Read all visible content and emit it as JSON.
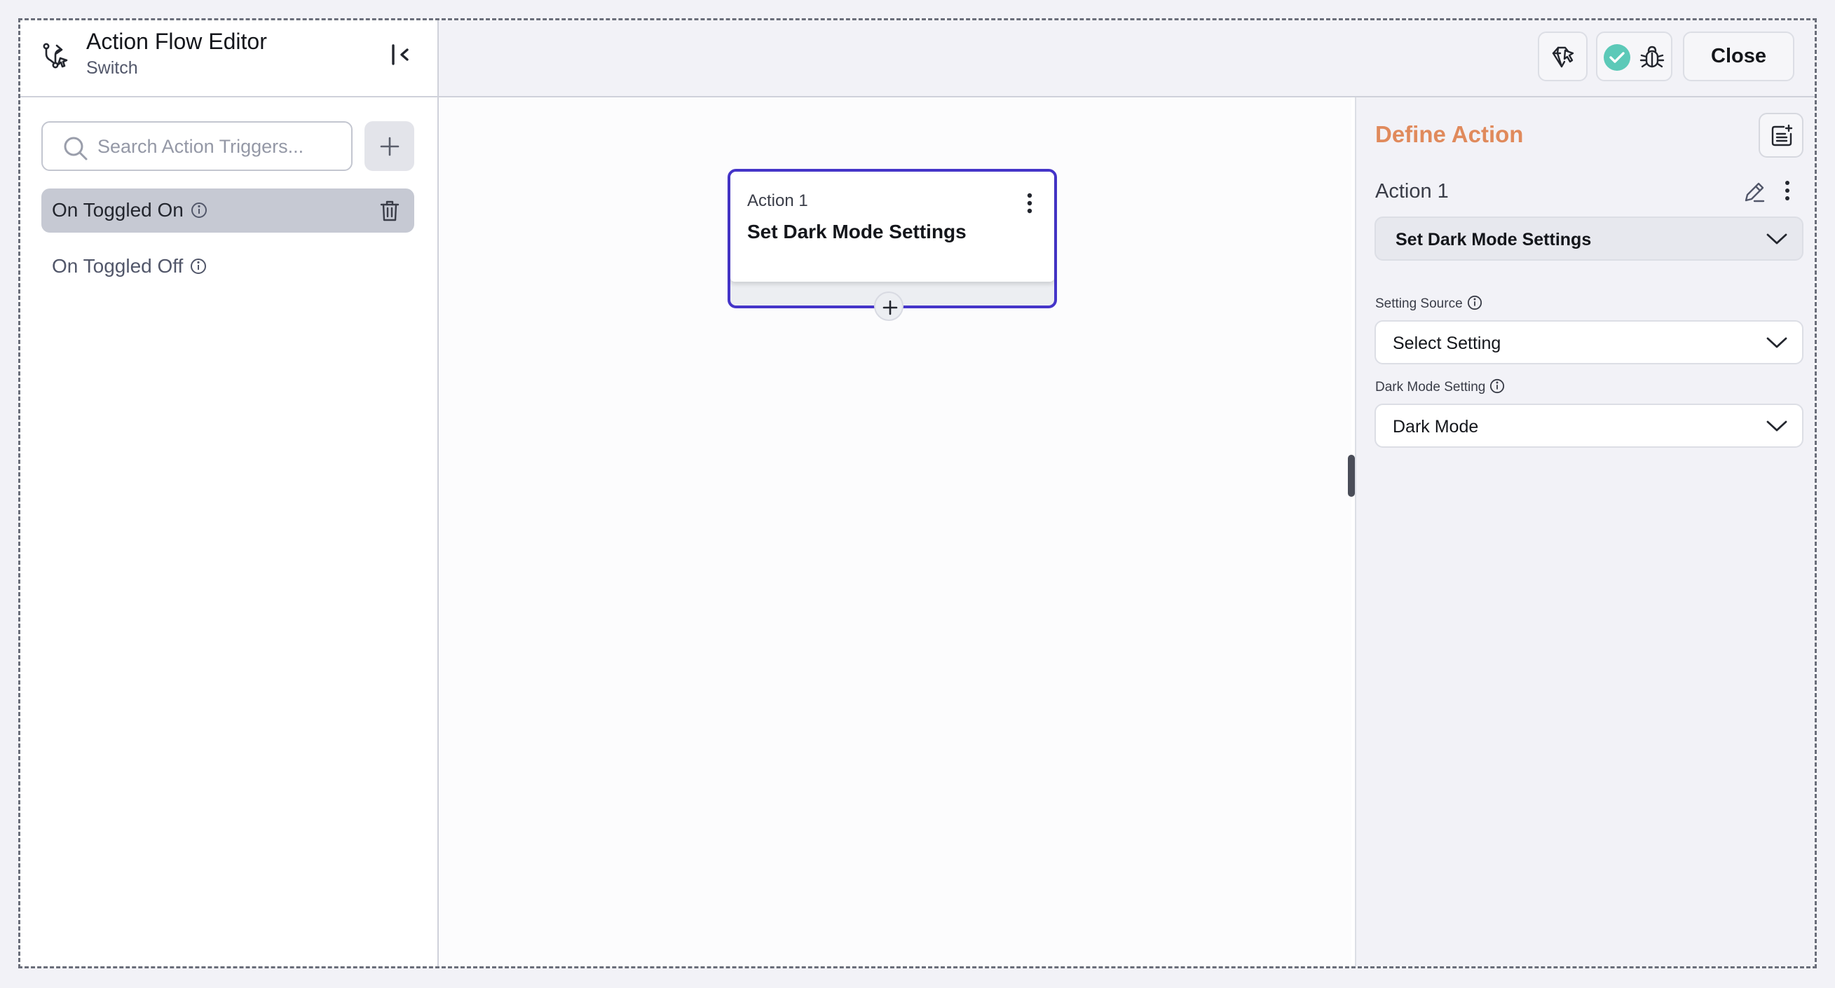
{
  "sidebar": {
    "title": "Action Flow Editor",
    "subtitle": "Switch",
    "search_placeholder": "Search Action Triggers...",
    "triggers": [
      {
        "label": "On Toggled On",
        "active": true
      },
      {
        "label": "On Toggled Off",
        "active": false
      }
    ]
  },
  "toolbar": {
    "close_label": "Close",
    "status_color": "#5cc9b8"
  },
  "canvas": {
    "node": {
      "label": "Action 1",
      "title": "Set Dark Mode Settings"
    }
  },
  "panel": {
    "title": "Define Action",
    "action_name": "Action 1",
    "action_type": "Set Dark Mode Settings",
    "fields": [
      {
        "label": "Setting Source",
        "value": "Select Setting"
      },
      {
        "label": "Dark Mode Setting",
        "value": "Dark Mode"
      }
    ]
  },
  "colors": {
    "accent_orange": "#e08a5c",
    "node_border": "#4535c9",
    "active_trigger_bg": "#c6c9d3"
  },
  "icons": [
    "flow-icon",
    "collapse-sidebar-icon",
    "search-icon",
    "plus-icon",
    "info-icon",
    "trash-icon",
    "ai-agent-icon",
    "check-circle-icon",
    "bug-icon",
    "more-vertical-icon",
    "edit-icon",
    "doc-add-icon",
    "chevron-down-icon"
  ]
}
